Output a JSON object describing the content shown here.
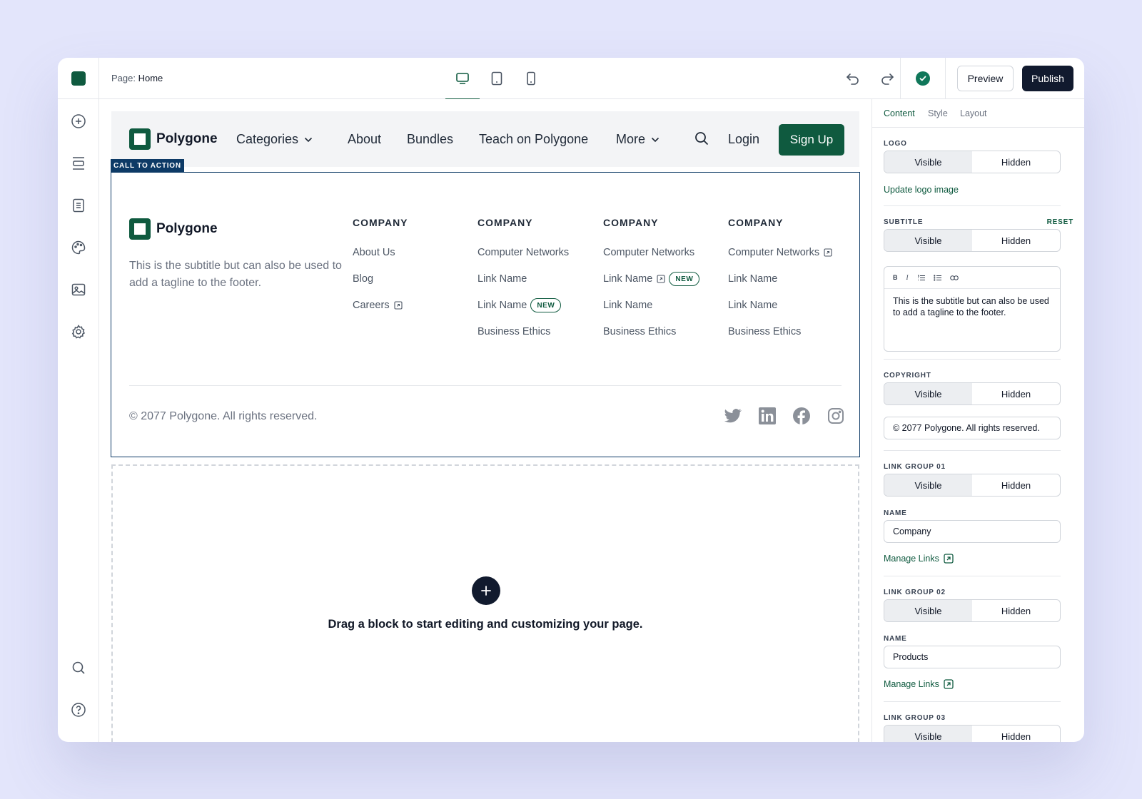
{
  "topbar": {
    "page_prefix": "Page:",
    "page_name": "Home",
    "preview_label": "Preview",
    "publish_label": "Publish"
  },
  "site_nav": {
    "brand": "Polygone",
    "categories": "Categories",
    "about": "About",
    "bundles": "Bundles",
    "teach": "Teach on Polygone",
    "more": "More",
    "login": "Login",
    "signup": "Sign Up"
  },
  "block_tag": "CALL TO ACTION",
  "footer": {
    "brand": "Polygone",
    "subtitle": "This is the subtitle but can also be used to add a tagline to the footer.",
    "columns": [
      {
        "heading": "COMPANY",
        "links": [
          "About Us",
          "Blog",
          "Careers"
        ]
      },
      {
        "heading": "COMPANY",
        "links": [
          "Computer Networks",
          "Link Name",
          "Link Name",
          "Business Ethics"
        ]
      },
      {
        "heading": "COMPANY",
        "links": [
          "Computer Networks",
          "Link Name",
          "Link Name",
          "Business Ethics"
        ]
      },
      {
        "heading": "COMPANY",
        "links": [
          "Computer Networks",
          "Link Name",
          "Link Name",
          "Business Ethics"
        ]
      }
    ],
    "badge": "NEW",
    "copyright": "© 2077 Polygone. All rights reserved."
  },
  "dropzone_text": "Drag a block to start editing and customizing your page.",
  "panel": {
    "tabs": [
      "Content",
      "Style",
      "Layout"
    ],
    "visible": "Visible",
    "hidden": "Hidden",
    "logo_label": "LOGO",
    "update_logo": "Update logo image",
    "subtitle_label": "SUBTITLE",
    "reset": "RESET",
    "subtitle_text": "This is the subtitle but can also be used to add a tagline to the footer.",
    "copyright_label": "COPYRIGHT",
    "copyright_value": "© 2077 Polygone. All rights reserved.",
    "group1_label": "LINK GROUP 01",
    "name_label": "NAME",
    "group1_name": "Company",
    "manage_links": "Manage Links",
    "group2_label": "LINK GROUP 02",
    "group2_name": "Products",
    "group3_label": "LINK GROUP 03"
  },
  "colors": {
    "brand": "#0f5a3f",
    "dark": "#111a2e",
    "selection": "#0d3a66",
    "background": "#e3e5fb"
  },
  "icons": [
    "add-block-icon",
    "sections-icon",
    "pages-icon",
    "palette-icon",
    "image-icon",
    "settings-icon",
    "search-icon",
    "help-icon",
    "desktop-icon",
    "tablet-icon",
    "mobile-icon",
    "undo-icon",
    "redo-icon",
    "check-icon",
    "twitter-icon",
    "linkedin-icon",
    "facebook-icon",
    "instagram-icon",
    "external-link-icon"
  ]
}
